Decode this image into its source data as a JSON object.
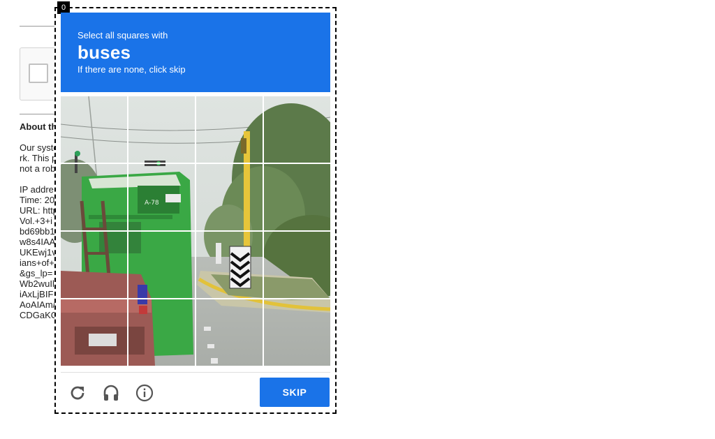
{
  "background_page": {
    "heading": "About th",
    "lines": [
      "Our syste",
      "rk. This p",
      "not a rob",
      "",
      "IP addre",
      "Time: 20",
      "URL: http",
      "Vol.+3+i",
      "bd69bb1",
      "w8s4IAA",
      "UKEwj1v",
      "ians+of+",
      "&gs_lp=",
      "Wb2wuIl",
      "iAxLjBIF",
      "AoAIAm/",
      "CDGaKO"
    ]
  },
  "challenge": {
    "frame_counter": "0",
    "instruction_line1": "Select all squares with",
    "keyword": "buses",
    "instruction_line3": "If there are none, click skip",
    "grid_rows": 4,
    "grid_cols": 4,
    "skip_label": "SKIP",
    "icons": [
      "reload-icon",
      "headphones-icon",
      "info-icon"
    ]
  },
  "colors": {
    "accent_blue": "#1a73e8",
    "bus_green": "#3aa845"
  }
}
